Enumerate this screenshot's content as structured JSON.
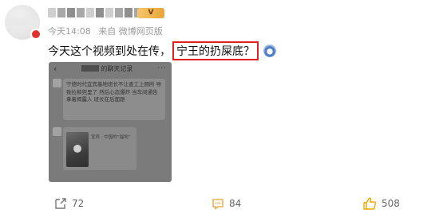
{
  "post": {
    "meta": {
      "time": "今天14:08",
      "source": "来自 微博网页版"
    },
    "text_before": "今天这个视频到处在传，",
    "text_highlight": "宁王的扔屎底？"
  },
  "embedded_screenshot": {
    "chat_title": "的聊天记录",
    "message": "宁德时代宜宾基地班长不让查工上厕所 导致拉裤兜里了 然后心态爆炸 当车间通告拿着揭露人 班长在后面跟",
    "video_caption": "宜宾 · 中国的“福地”"
  },
  "actions": {
    "share_count": "72",
    "comment_count": "84",
    "like_count": "508"
  },
  "colors": {
    "highlight_border": "#e02020",
    "accent": "#f2a500"
  }
}
